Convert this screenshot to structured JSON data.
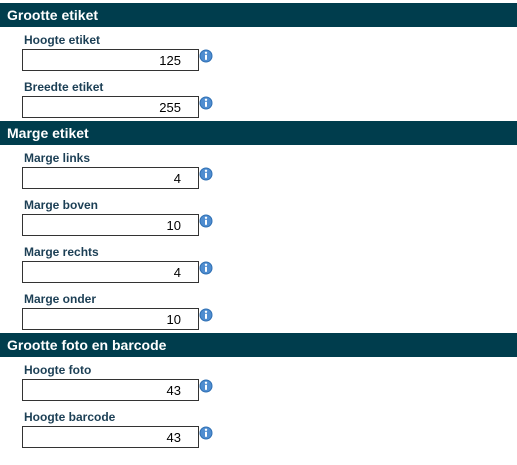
{
  "sections": [
    {
      "title": "Grootte etiket",
      "fields": [
        {
          "label": "Hoogte etiket",
          "value": "125"
        },
        {
          "label": "Breedte etiket",
          "value": "255"
        }
      ]
    },
    {
      "title": "Marge etiket",
      "fields": [
        {
          "label": "Marge links",
          "value": "4"
        },
        {
          "label": "Marge boven",
          "value": "10"
        },
        {
          "label": "Marge rechts",
          "value": "4"
        },
        {
          "label": "Marge onder",
          "value": "10"
        }
      ]
    },
    {
      "title": "Grootte foto en barcode",
      "fields": [
        {
          "label": "Hoogte foto",
          "value": "43"
        },
        {
          "label": "Hoogte barcode",
          "value": "43"
        }
      ]
    }
  ],
  "icons": {
    "field_help": "info-icon"
  },
  "colors": {
    "header_bg": "#003d4d",
    "header_text": "#ffffff",
    "label_text": "#1c3f55",
    "icon": "#2e6fb3"
  }
}
